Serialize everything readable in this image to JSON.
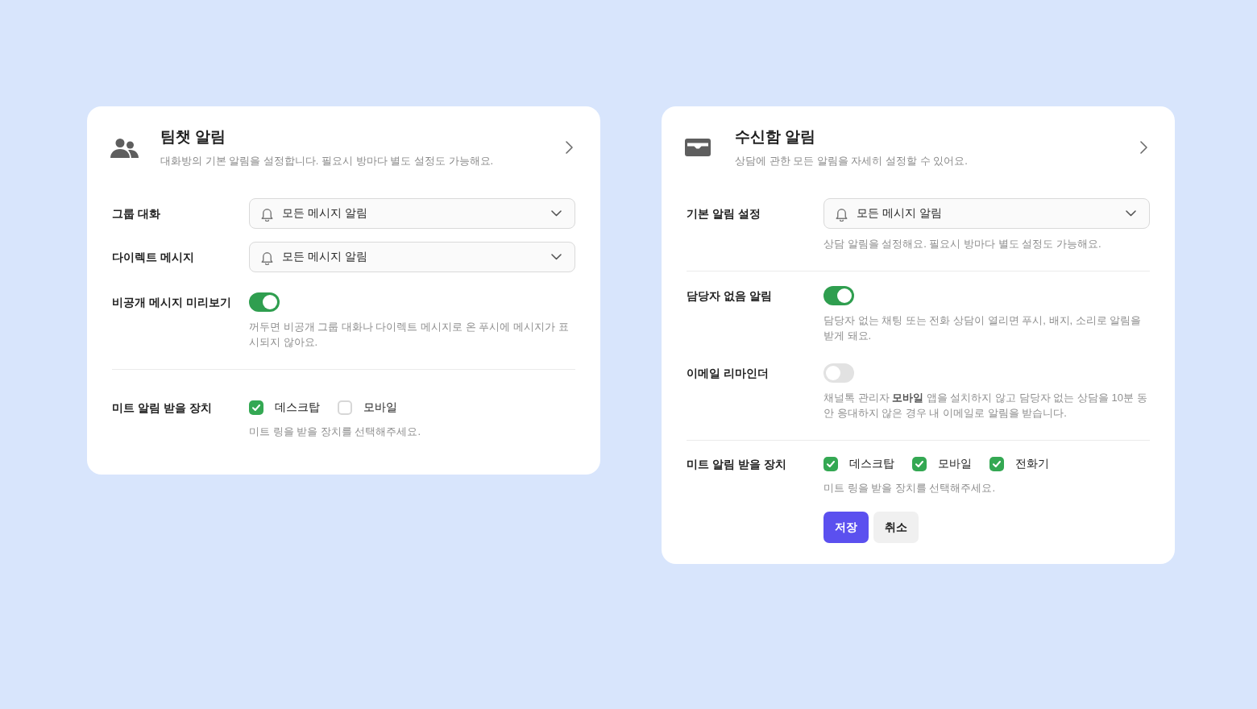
{
  "cards": [
    {
      "title": "팀챗 알림",
      "description": "대화방의 기본 알림을 설정합니다. 필요시 방마다 별도 설정도 가능해요.",
      "rows": [
        {
          "kind": "select",
          "label": "그룹 대화",
          "value": "모든 메시지 알림"
        },
        {
          "kind": "select",
          "label": "다이렉트 메시지",
          "value": "모든 메시지 알림"
        },
        {
          "kind": "toggle",
          "label": "비공개 메시지 미리보기",
          "on": true,
          "help": "꺼두면 비공개 그룹 대화나 다이렉트 메시지로 온 푸시에 메시지가 표시되지 않아요."
        },
        {
          "kind": "divider"
        },
        {
          "kind": "checkboxes",
          "label": "미트 알림 받을 장치",
          "options": [
            {
              "label": "데스크탑",
              "checked": true
            },
            {
              "label": "모바일",
              "checked": false
            }
          ],
          "help": "미트 링을 받을 장치를 선택해주세요."
        }
      ]
    },
    {
      "title": "수신함 알림",
      "description": "상담에 관한 모든 알림을 자세히 설정할 수 있어요.",
      "rows": [
        {
          "kind": "select",
          "label": "기본 알림 설정",
          "value": "모든 메시지 알림",
          "help": "상담 알림을 설정해요. 필요시 방마다 별도 설정도 가능해요."
        },
        {
          "kind": "divider"
        },
        {
          "kind": "toggle",
          "label": "담당자 없음 알림",
          "on": true,
          "help": "담당자 없는 채팅 또는 전화 상담이 열리면 푸시, 배지, 소리로 알림을 받게 돼요."
        },
        {
          "kind": "toggle",
          "label": "이메일 리마인더",
          "on": false,
          "help": "채널톡 관리자 **모바일** 앱을 설치하지 않고 담당자 없는 상담을 10분 동안 응대하지 않은 경우 내 이메일로 알림을 받습니다."
        },
        {
          "kind": "divider"
        },
        {
          "kind": "checkboxes",
          "label": "미트 알림 받을 장치",
          "options": [
            {
              "label": "데스크탑",
              "checked": true
            },
            {
              "label": "모바일",
              "checked": true
            },
            {
              "label": "전화기",
              "checked": true
            }
          ],
          "help": "미트 링을 받을 장치를 선택해주세요."
        }
      ],
      "buttons": [
        {
          "label": "저장",
          "kind": "primary"
        },
        {
          "label": "취소",
          "kind": "secondary"
        }
      ]
    }
  ]
}
